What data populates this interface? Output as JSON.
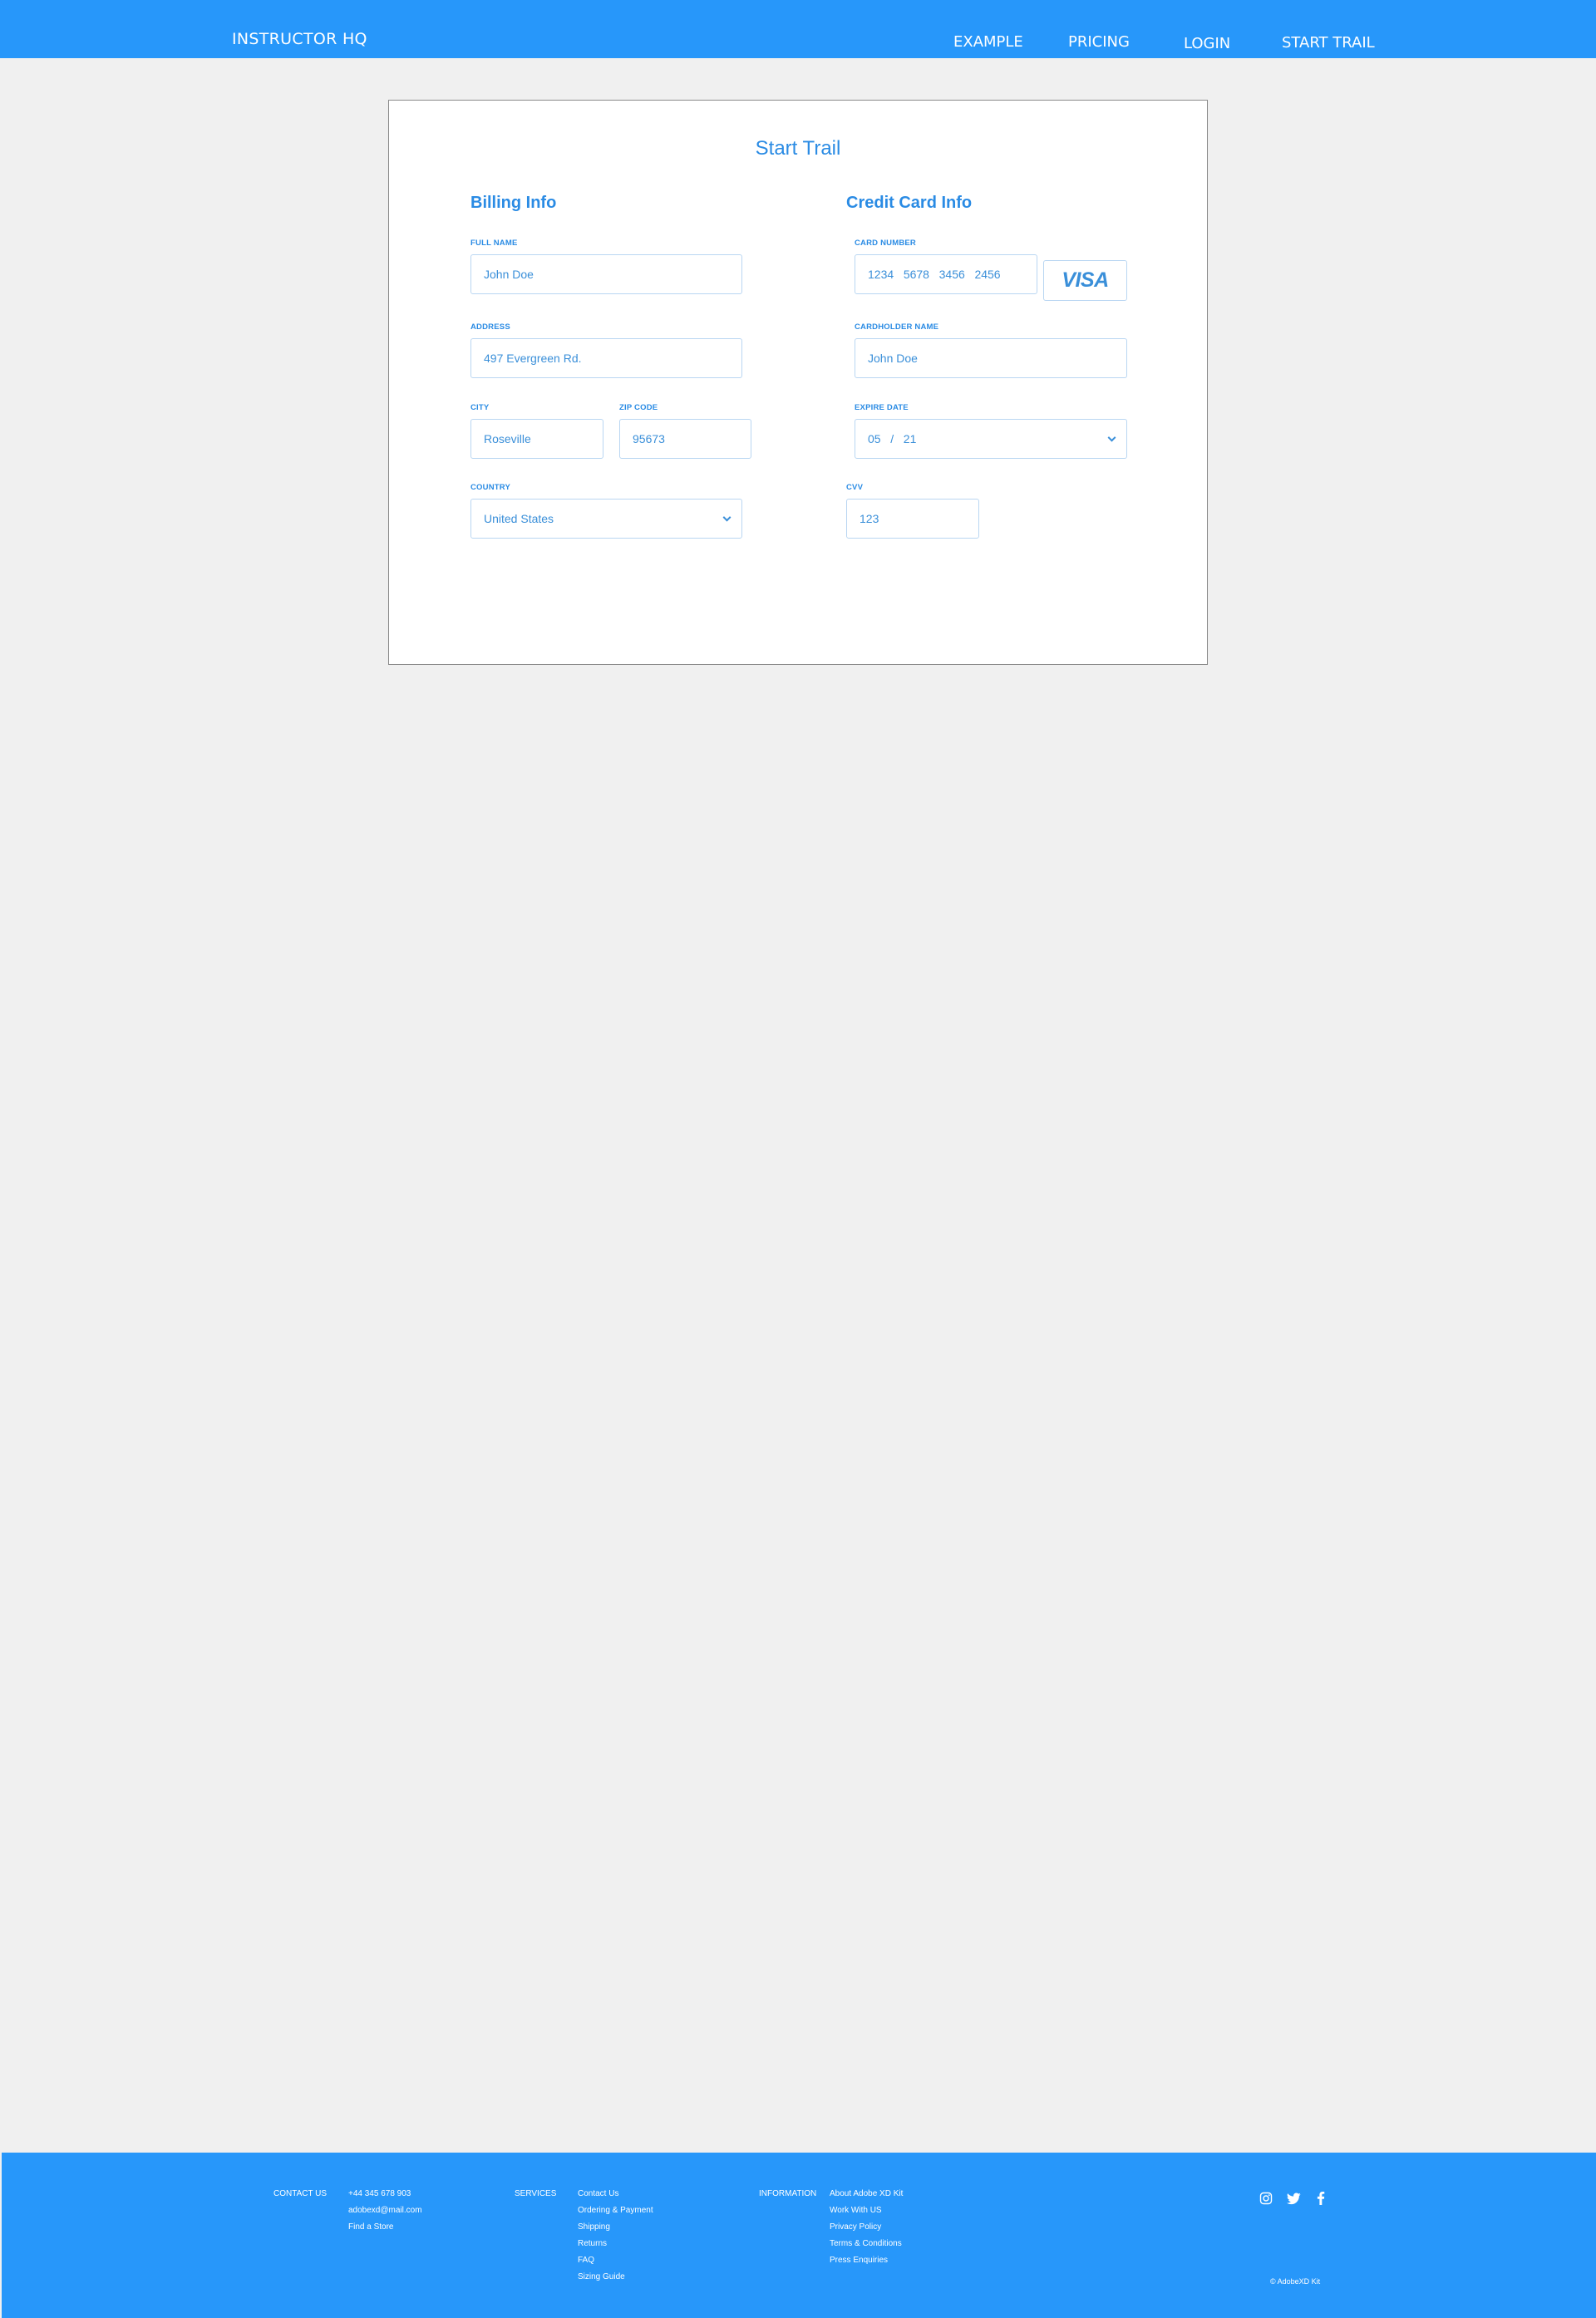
{
  "header": {
    "brand": "INSTRUCTOR HQ",
    "nav": [
      "EXAMPLE",
      "PRICING",
      "LOGIN",
      "START TRAIL"
    ]
  },
  "page": {
    "title": "Start Trail",
    "billing": {
      "heading": "Billing Info",
      "full_name_label": "FULL NAME",
      "full_name_value": "John Doe",
      "address_label": "ADDRESS",
      "address_value": "497 Evergreen Rd.",
      "city_label": "CITY",
      "city_value": "Roseville",
      "zip_label": "ZIP CODE",
      "zip_value": "95673",
      "country_label": "COUNTRY",
      "country_value": "United States"
    },
    "credit": {
      "heading": "Credit Card Info",
      "card_number_label": "CARD NUMBER",
      "card_number_value": "1234   5678   3456   2456",
      "card_brand": "VISA",
      "cardholder_label": "CARDHOLDER NAME",
      "cardholder_value": "John Doe",
      "expire_label": "EXPIRE DATE",
      "expire_value": "05   /   21",
      "cvv_label": "CVV",
      "cvv_value": "123"
    }
  },
  "footer": {
    "contact_heading": "CONTACT US",
    "contact_items": [
      "+44 345 678 903",
      "adobexd@mail.com",
      "Find a Store"
    ],
    "services_heading": "SERVICES",
    "services_items": [
      "Contact Us",
      "Ordering & Payment",
      "Shipping",
      "Returns",
      "FAQ",
      "Sizing Guide"
    ],
    "information_heading": "INFORMATION",
    "information_items": [
      "About Adobe XD Kit",
      "Work With US",
      "Privacy Policy",
      "Terms & Conditions",
      "Press Enquiries"
    ],
    "social_icons": [
      "instagram-icon",
      "twitter-icon",
      "facebook-icon"
    ],
    "copyright": "© AdobeXD Kit"
  },
  "colors": {
    "accent": "#2797fa",
    "text_accent": "#2a8be4",
    "background": "#f0f0f0"
  }
}
